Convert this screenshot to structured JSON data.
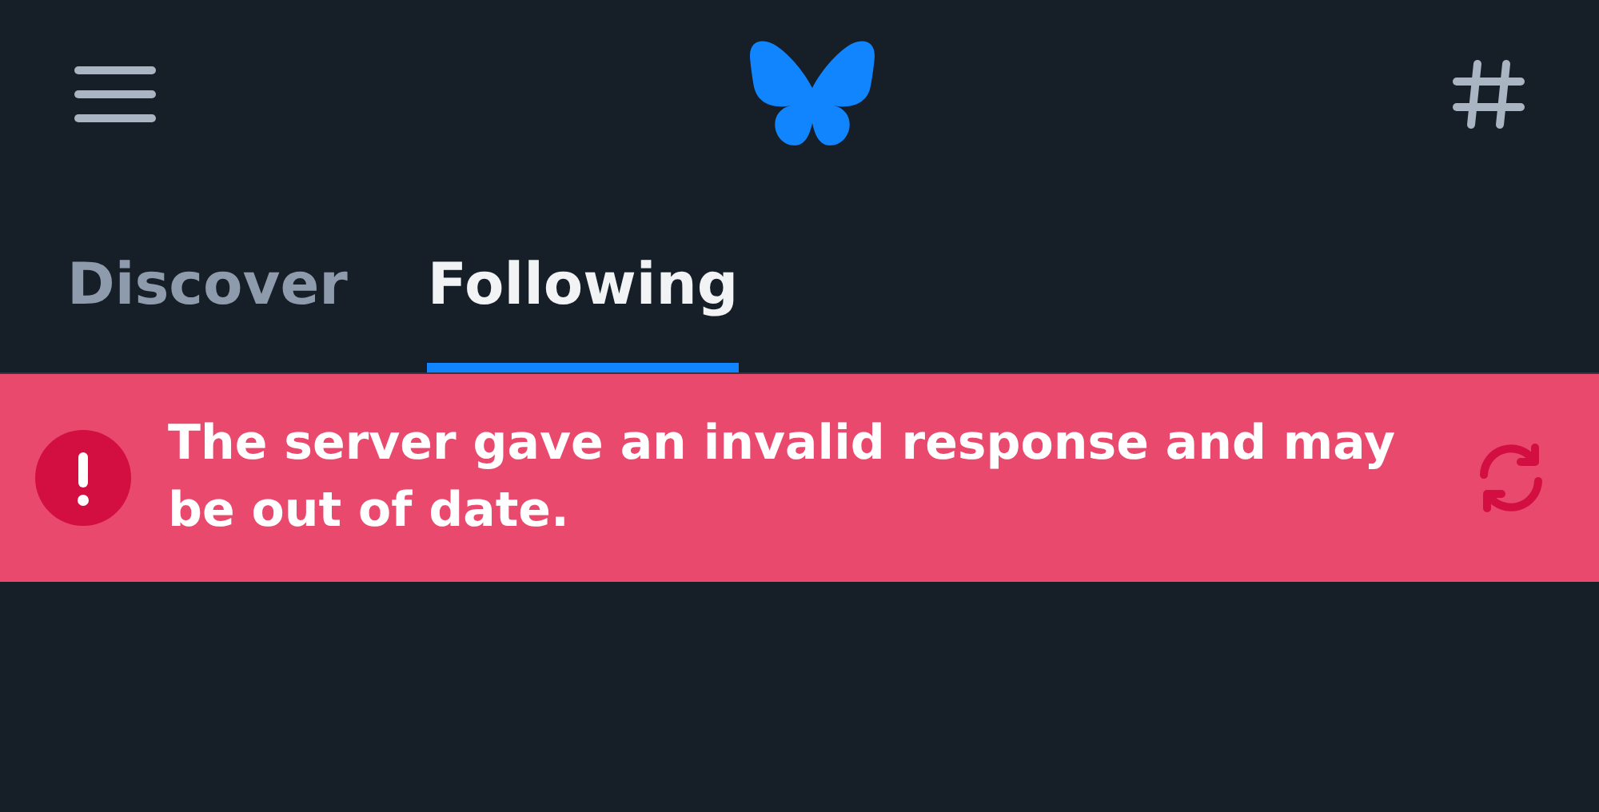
{
  "tabs": [
    {
      "label": "Discover",
      "selected": false
    },
    {
      "label": "Following",
      "selected": true
    }
  ],
  "error_banner": {
    "message": "The server gave an invalid response and may be out of date."
  }
}
